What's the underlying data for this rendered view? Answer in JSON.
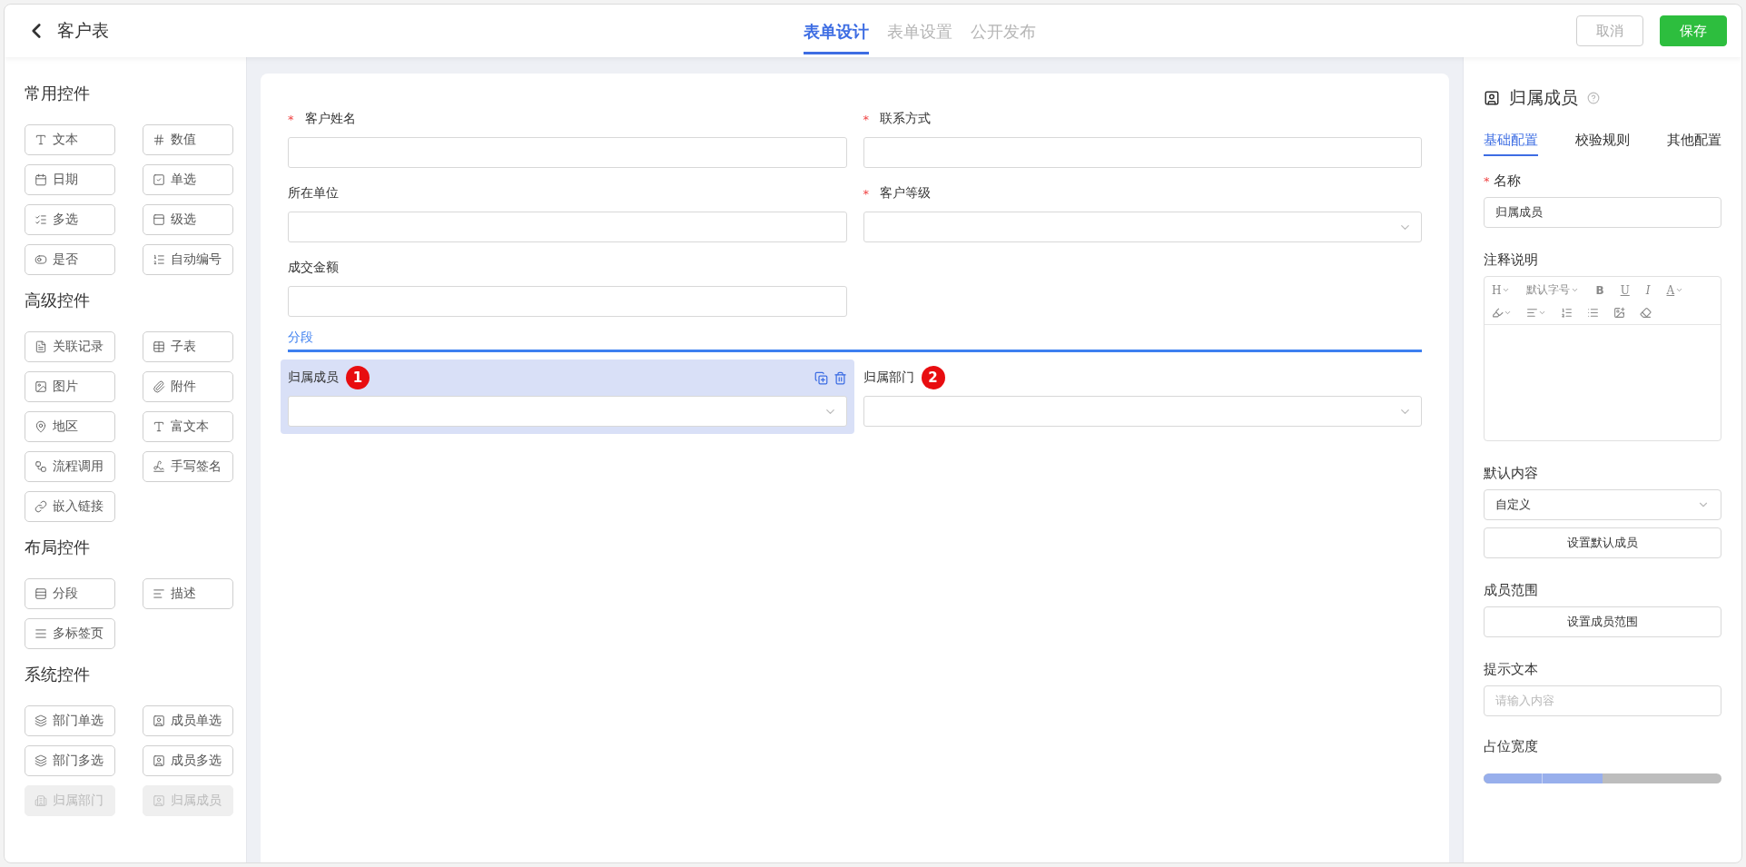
{
  "required_mark": "*",
  "header": {
    "title": "客户表",
    "tabs": [
      {
        "label": "表单设计",
        "selected": true
      },
      {
        "label": "表单设置",
        "selected": false
      },
      {
        "label": "公开发布",
        "selected": false
      }
    ],
    "buttons": [
      {
        "label": "取消",
        "kind": "secondary"
      },
      {
        "label": "保存",
        "kind": "primary"
      }
    ]
  },
  "palette": [
    {
      "title": "常用控件",
      "items": [
        {
          "label": "文本",
          "disabled": false
        },
        {
          "label": "数值",
          "disabled": false
        },
        {
          "label": "日期",
          "disabled": false
        },
        {
          "label": "单选",
          "disabled": false
        },
        {
          "label": "多选",
          "disabled": false
        },
        {
          "label": "级选",
          "disabled": false
        },
        {
          "label": "是否",
          "disabled": false
        },
        {
          "label": "自动编号",
          "disabled": false
        }
      ]
    },
    {
      "title": "高级控件",
      "items": [
        {
          "label": "关联记录",
          "disabled": false
        },
        {
          "label": "子表",
          "disabled": false
        },
        {
          "label": "图片",
          "disabled": false
        },
        {
          "label": "附件",
          "disabled": false
        },
        {
          "label": "地区",
          "disabled": false
        },
        {
          "label": "富文本",
          "disabled": false
        },
        {
          "label": "流程调用",
          "disabled": false
        },
        {
          "label": "手写签名",
          "disabled": false
        },
        {
          "label": "嵌入链接",
          "disabled": false
        }
      ]
    },
    {
      "title": "布局控件",
      "items": [
        {
          "label": "分段",
          "disabled": false
        },
        {
          "label": "描述",
          "disabled": false
        },
        {
          "label": "多标签页",
          "disabled": false
        }
      ]
    },
    {
      "title": "系统控件",
      "items": [
        {
          "label": "部门单选",
          "disabled": false
        },
        {
          "label": "成员单选",
          "disabled": false
        },
        {
          "label": "部门多选",
          "disabled": false
        },
        {
          "label": "成员多选",
          "disabled": false
        },
        {
          "label": "归属部门",
          "disabled": true
        },
        {
          "label": "归属成员",
          "disabled": true
        }
      ]
    }
  ],
  "form": {
    "fields": [
      {
        "label": "客户姓名",
        "required": true,
        "kind": "text",
        "selected": false
      },
      {
        "label": "联系方式",
        "required": true,
        "kind": "text",
        "selected": false
      },
      {
        "label": "所在单位",
        "required": false,
        "kind": "text",
        "selected": false
      },
      {
        "label": "客户等级",
        "required": true,
        "kind": "select",
        "selected": false
      },
      {
        "label": "成交金额",
        "required": false,
        "kind": "text",
        "selected": false
      }
    ],
    "section": {
      "title": "分段",
      "fields": [
        {
          "label": "归属成员",
          "required": false,
          "kind": "select",
          "selected": true,
          "badge": "1"
        },
        {
          "label": "归属部门",
          "required": false,
          "kind": "select",
          "selected": false,
          "badge": "2"
        }
      ]
    }
  },
  "properties": {
    "title": "归属成员",
    "tabs": [
      {
        "label": "基础配置",
        "selected": true
      },
      {
        "label": "校验规则",
        "selected": false
      },
      {
        "label": "其他配置",
        "selected": false
      }
    ],
    "name": {
      "label": "名称",
      "required": true,
      "value": "归属成员"
    },
    "note": {
      "label": "注释说明",
      "toolbar": [
        {
          "label": "H",
          "kind": "caret"
        },
        {
          "label": "默认字号",
          "kind": "caret"
        },
        {
          "label": "B",
          "kind": "bold"
        },
        {
          "label": "U",
          "kind": "underline"
        },
        {
          "label": "I",
          "kind": "italic"
        },
        {
          "label": "A",
          "kind": "color"
        }
      ]
    },
    "default": {
      "label": "默认内容",
      "value": "自定义",
      "button": "设置默认成员"
    },
    "range": {
      "label": "成员范围",
      "button": "设置成员范围"
    },
    "hint": {
      "label": "提示文本",
      "placeholder": "请输入内容"
    },
    "width": {
      "label": "占位宽度",
      "level": 0.5
    }
  }
}
